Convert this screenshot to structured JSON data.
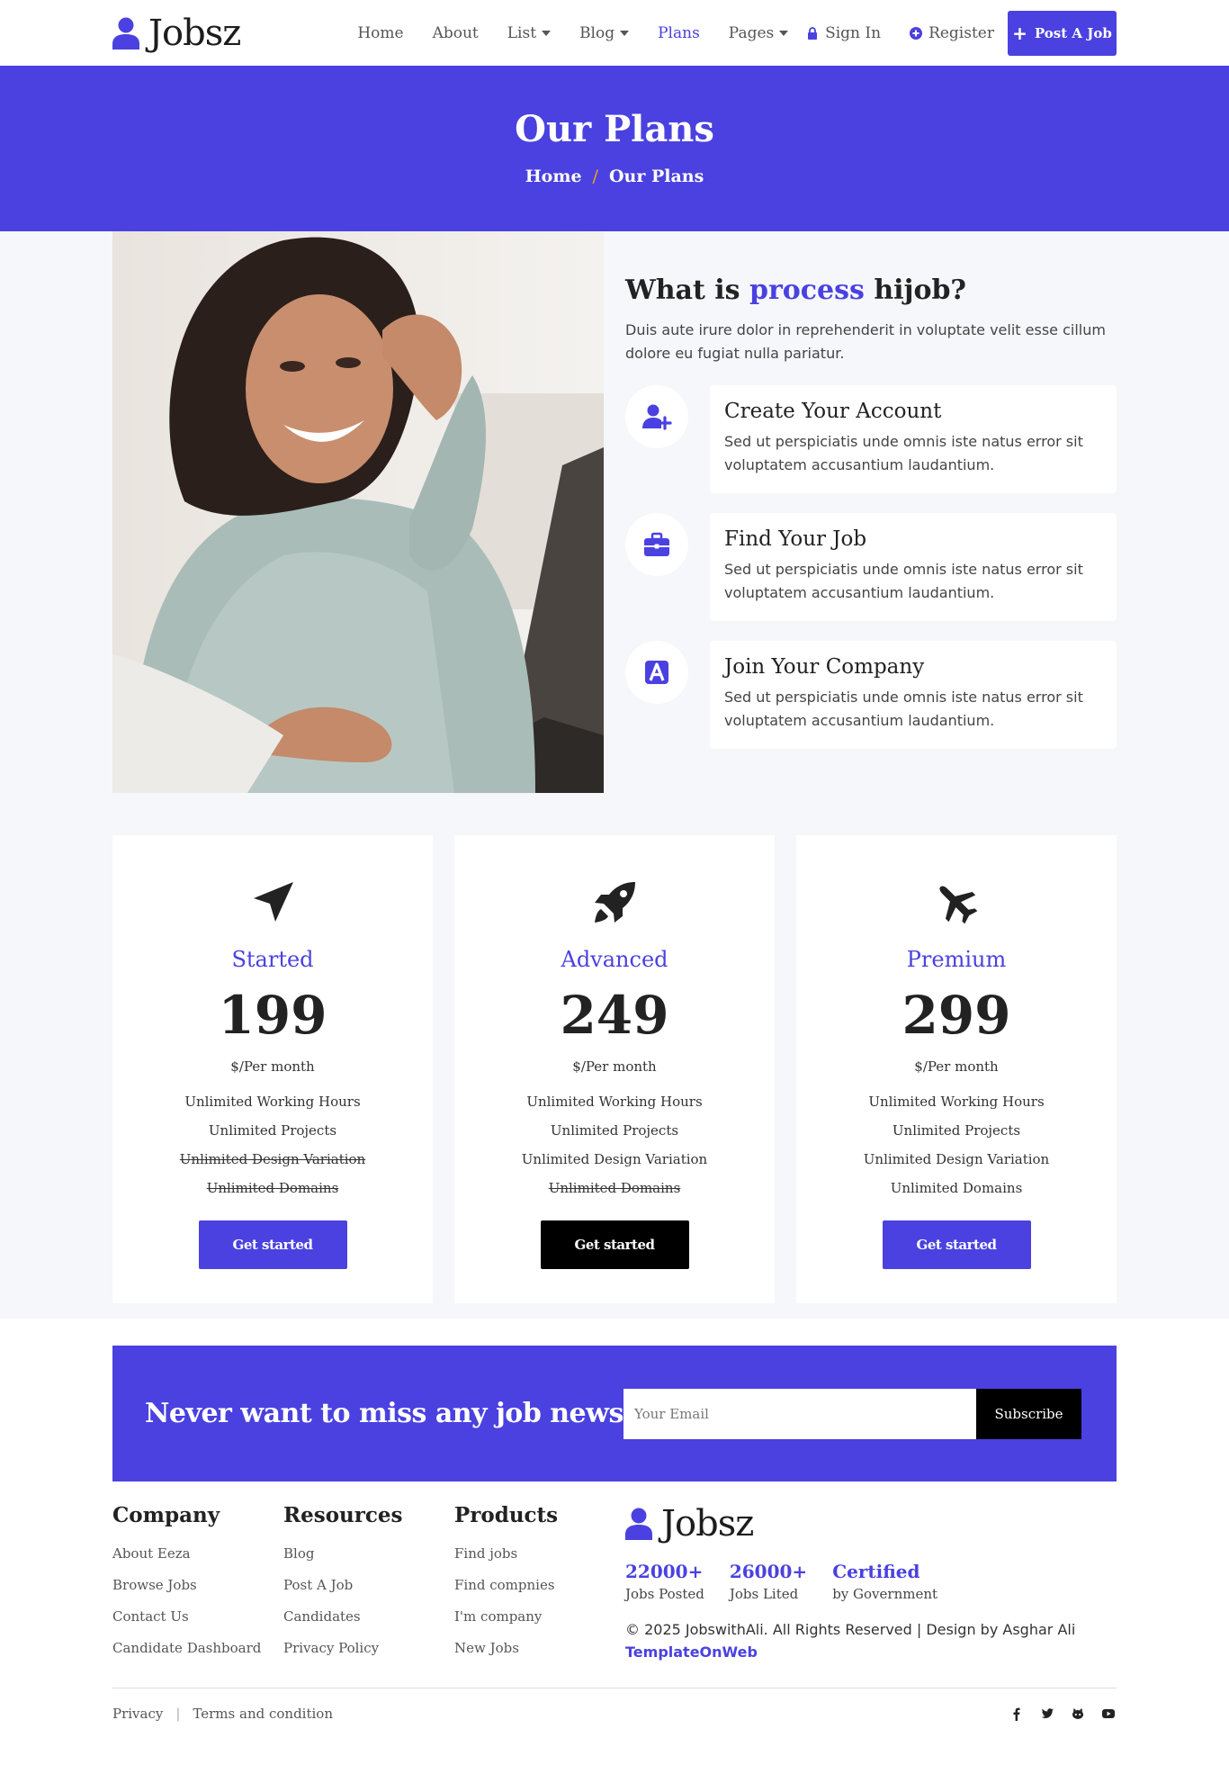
{
  "colors": {
    "accent": "#4a41e0",
    "dark": "#000000",
    "section_bg": "#f6f7fa",
    "crumb_separator": "#f7a31b"
  },
  "nav": {
    "brand": "Jobsz",
    "menu": [
      {
        "label": "Home",
        "dropdown": false,
        "active": false
      },
      {
        "label": "About",
        "dropdown": false,
        "active": false
      },
      {
        "label": "List",
        "dropdown": true,
        "active": false
      },
      {
        "label": "Blog",
        "dropdown": true,
        "active": false
      },
      {
        "label": "Plans",
        "dropdown": false,
        "active": true
      },
      {
        "label": "Pages",
        "dropdown": true,
        "active": false
      }
    ],
    "sign_in": "Sign In",
    "register": "Register",
    "post_job": "Post A Job"
  },
  "hero": {
    "title": "Our Plans",
    "breadcrumb": [
      "Home",
      "/",
      "Our Plans"
    ]
  },
  "process": {
    "heading_pre": "What is",
    "heading_accent": "process",
    "heading_post": "hijob?",
    "intro": "Duis aute irure dolor in reprehenderit in voluptate velit esse cillum dolore eu fugiat nulla pariatur.",
    "steps": [
      {
        "icon": "user-plus-icon",
        "title": "Create Your Account",
        "text": "Sed ut perspiciatis unde omnis iste natus error sit voluptatem accusantium laudantium."
      },
      {
        "icon": "briefcase-icon",
        "title": "Find Your Job",
        "text": "Sed ut perspiciatis unde omnis iste natus error sit voluptatem accusantium laudantium."
      },
      {
        "icon": "company-a-icon",
        "title": "Join Your Company",
        "text": "Sed ut perspiciatis unde omnis iste natus error sit voluptatem accusantium laudantium."
      }
    ]
  },
  "plans": [
    {
      "icon": "paper-plane-icon",
      "name": "Started",
      "price": "199",
      "period": "$/Per month",
      "features": [
        {
          "label": "Unlimited Working Hours",
          "included": true
        },
        {
          "label": "Unlimited Projects",
          "included": true
        },
        {
          "label": "Unlimited Design Variation",
          "included": false
        },
        {
          "label": "Unlimited Domains",
          "included": false
        }
      ],
      "button": "Get started"
    },
    {
      "icon": "rocket-icon",
      "name": "Advanced",
      "price": "249",
      "period": "$/Per month",
      "features": [
        {
          "label": "Unlimited Working Hours",
          "included": true
        },
        {
          "label": "Unlimited Projects",
          "included": true
        },
        {
          "label": "Unlimited Design Variation",
          "included": true
        },
        {
          "label": "Unlimited Domains",
          "included": false
        }
      ],
      "button": "Get started"
    },
    {
      "icon": "airplane-icon",
      "name": "Premium",
      "price": "299",
      "period": "$/Per month",
      "features": [
        {
          "label": "Unlimited Working Hours",
          "included": true
        },
        {
          "label": "Unlimited Projects",
          "included": true
        },
        {
          "label": "Unlimited Design Variation",
          "included": true
        },
        {
          "label": "Unlimited Domains",
          "included": true
        }
      ],
      "button": "Get started"
    }
  ],
  "newsletter": {
    "heading": "Never want to miss any job news",
    "placeholder": "Your Email",
    "button": "Subscribe"
  },
  "footer": {
    "columns": [
      {
        "title": "Company",
        "links": [
          "About Eeza",
          "Browse Jobs",
          "Contact Us",
          "Candidate Dashboard"
        ]
      },
      {
        "title": "Resources",
        "links": [
          "Blog",
          "Post A Job",
          "Candidates",
          "Privacy Policy"
        ]
      },
      {
        "title": "Products",
        "links": [
          "Find jobs",
          "Find compnies",
          "I'm company",
          "New Jobs"
        ]
      }
    ],
    "brand": "Jobsz",
    "stats": [
      {
        "value": "22000+",
        "label": "Jobs Posted"
      },
      {
        "value": "26000+",
        "label": "Jobs Lited"
      },
      {
        "value": "Certified",
        "label": "by Government"
      }
    ],
    "copyright": "© 2025 JobswithAli. All Rights Reserved | Design by Asghar Ali",
    "copyright_link": "TemplateOnWeb",
    "bottom_links": [
      "Privacy",
      "Terms and condition"
    ],
    "bottom_separator": "|",
    "socials": [
      "facebook-icon",
      "twitter-icon",
      "github-icon",
      "youtube-icon"
    ]
  }
}
